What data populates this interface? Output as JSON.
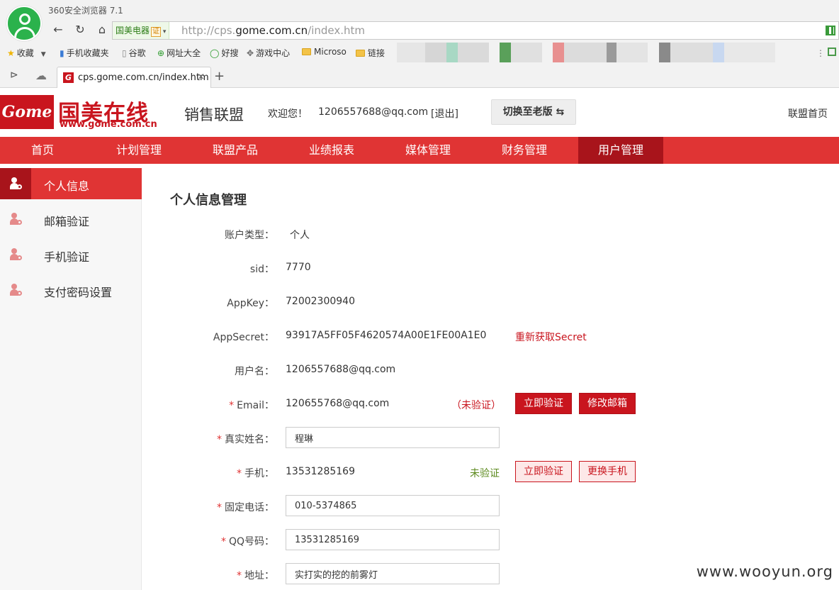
{
  "browser": {
    "title": "360安全浏览器 7.1",
    "site_badge": "国美电器",
    "cert_badge": "证",
    "url_prefix": "http://cps.",
    "url_host": "gome.com.cn",
    "url_path": "/index.htm",
    "bookmarks": [
      "收藏",
      "手机收藏夹",
      "谷歌",
      "网址大全",
      "好搜",
      "游戏中心",
      "Microso",
      "链接"
    ],
    "tab_title": "cps.gome.com.cn/index.htm",
    "tab_close": "×",
    "new_tab": "+"
  },
  "site": {
    "logo_mark": "Gome",
    "logo_cn": "国美在线",
    "logo_url": "www.gome.com.cn",
    "alliance": "销售联盟",
    "welcome": "欢迎您！",
    "user_email": "1206557688@qq.com",
    "logout": "[退出]",
    "switch_old": "切换至老版 ⇆",
    "home_link": "联盟首页"
  },
  "nav": {
    "items": [
      "首页",
      "计划管理",
      "联盟产品",
      "业绩报表",
      "媒体管理",
      "财务管理",
      "用户管理"
    ],
    "active_index": 6
  },
  "sidebar": {
    "items": [
      "个人信息",
      "邮箱验证",
      "手机验证",
      "支付密码设置"
    ],
    "active_index": 0
  },
  "profile": {
    "title": "个人信息管理",
    "account_type_label": "账户类型：",
    "account_type": "个人",
    "sid_label": "sid：",
    "sid": "7770",
    "appkey_label": "AppKey：",
    "appkey": "72002300940",
    "appsecret_label": "AppSecret：",
    "appsecret": "93917A5FF05F4620574A00E1FE00A1E0",
    "refresh_secret": "重新获取Secret",
    "username_label": "用户名：",
    "username": "1206557688@qq.com",
    "email_label": "Email：",
    "email": "120655768@qq.com",
    "email_status": "（未验证）",
    "verify_now": "立即验证",
    "change_email": "修改邮箱",
    "realname_label": "真实姓名：",
    "realname": "程琳",
    "phone_label": "手机：",
    "phone": "13531285169",
    "phone_status": "未验证",
    "change_phone": "更换手机",
    "landline_label": "固定电话：",
    "landline": "010-5374865",
    "qq_label": "QQ号码：",
    "qq": "13531285169",
    "address_label": "地址：",
    "address": "实打实的挖的前雾灯",
    "required_mark": "*"
  },
  "watermark": "www.wooyun.org"
}
